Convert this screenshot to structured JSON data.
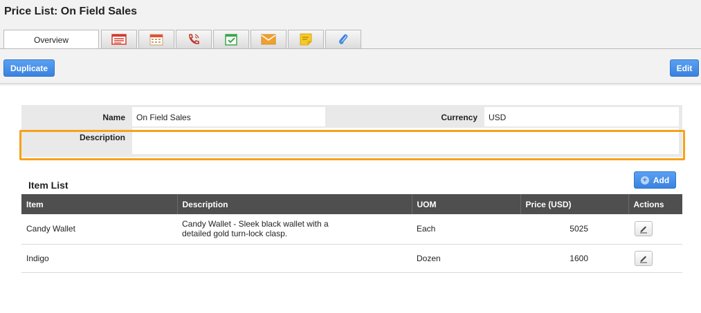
{
  "page": {
    "title": "Price List: On Field Sales"
  },
  "tabs": [
    {
      "label": "Overview",
      "icon": "overview",
      "active": true
    },
    {
      "icon": "list-icon"
    },
    {
      "icon": "calendar-icon"
    },
    {
      "icon": "phone-call-icon"
    },
    {
      "icon": "task-check-icon"
    },
    {
      "icon": "email-icon"
    },
    {
      "icon": "note-icon"
    },
    {
      "icon": "attachment-icon"
    }
  ],
  "toolbar": {
    "duplicate_label": "Duplicate",
    "edit_label": "Edit"
  },
  "form": {
    "name_label": "Name",
    "name_value": "On Field Sales",
    "currency_label": "Currency",
    "currency_value": "USD",
    "description_label": "Description",
    "description_value": ""
  },
  "item_list": {
    "title": "Item List",
    "add_label": "Add",
    "columns": [
      "Item",
      "Description",
      "UOM",
      "Price (USD)",
      "Actions"
    ],
    "rows": [
      {
        "item": "Candy Wallet",
        "description": "Candy Wallet - Sleek black wallet with a detailed gold turn-lock clasp.",
        "uom": "Each",
        "price": "5025"
      },
      {
        "item": "Indigo",
        "description": "",
        "uom": "Dozen",
        "price": "1600"
      }
    ]
  },
  "colors": {
    "accent": "#3a82e0",
    "header_bg": "#4f4f4f",
    "highlight": "#f7a11a"
  }
}
